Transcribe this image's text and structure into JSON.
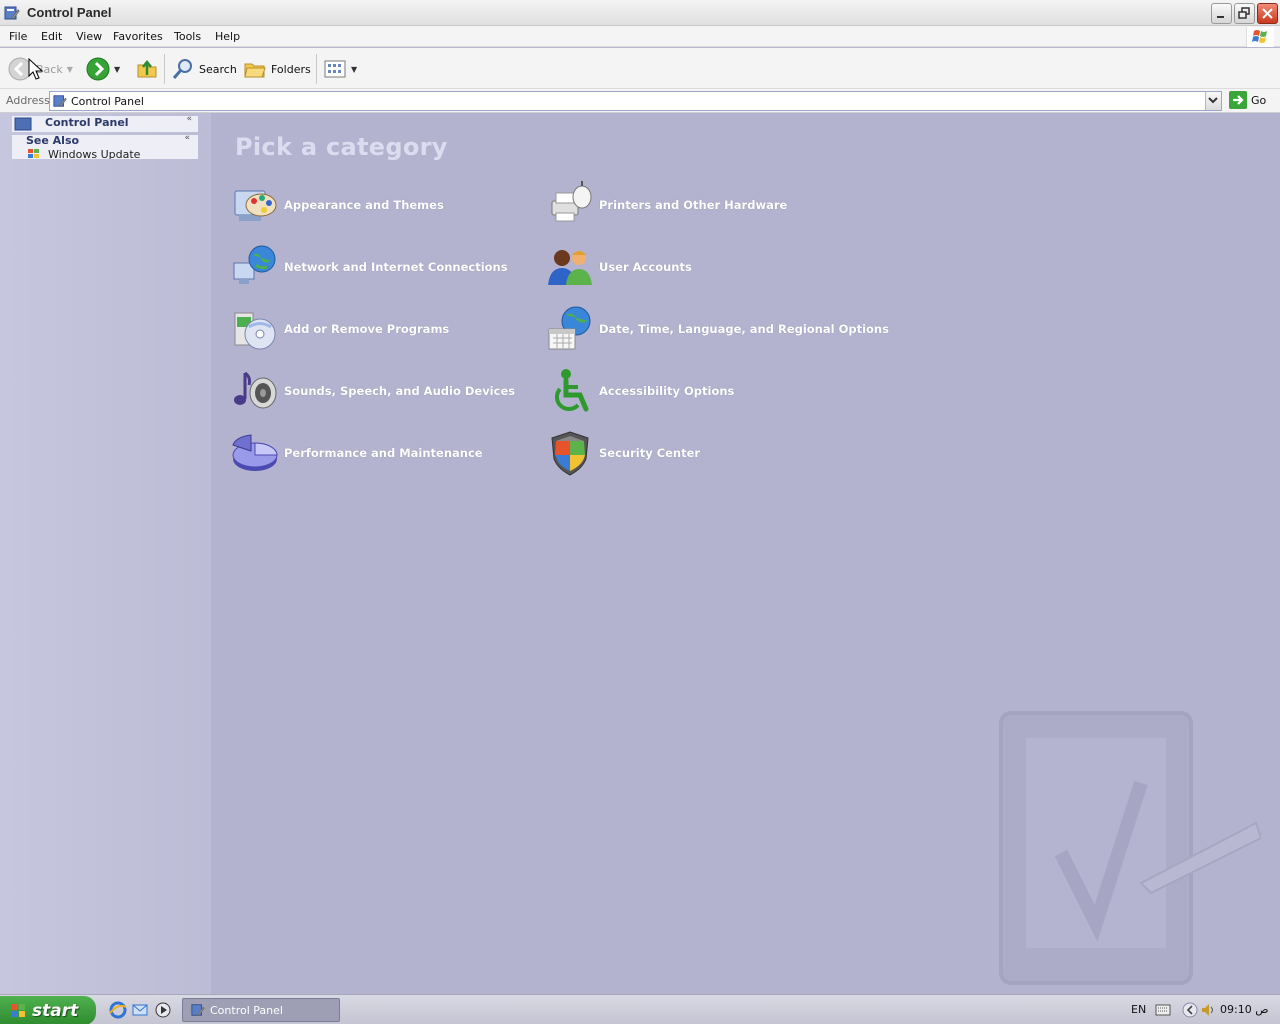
{
  "window": {
    "title": "Control Panel",
    "title_icon": "control-panel-icon",
    "buttons": [
      "minimize",
      "restore",
      "close"
    ]
  },
  "menubar": {
    "items": [
      "File",
      "Edit",
      "View",
      "Favorites",
      "Tools",
      "Help"
    ]
  },
  "toolbar": {
    "back_label": "Back",
    "search_label": "Search",
    "folders_label": "Folders"
  },
  "address": {
    "label": "Address",
    "value": "Control Panel",
    "go_label": "Go"
  },
  "leftpane": {
    "control_panel_title": "Control Panel",
    "see_also_title": "See Also",
    "see_also_links": [
      "Windows Update"
    ]
  },
  "main": {
    "heading": "Pick a category",
    "categories": [
      {
        "label": "Appearance and Themes",
        "icon": "appearance-themes-icon"
      },
      {
        "label": "Printers and Other Hardware",
        "icon": "printer-hardware-icon"
      },
      {
        "label": "Network and Internet Connections",
        "icon": "network-globe-icon"
      },
      {
        "label": "User Accounts",
        "icon": "user-accounts-icon"
      },
      {
        "label": "Add or Remove Programs",
        "icon": "add-remove-programs-icon"
      },
      {
        "label": "Date, Time, Language, and Regional Options",
        "icon": "date-time-globe-icon"
      },
      {
        "label": "Sounds, Speech, and Audio Devices",
        "icon": "sound-speaker-icon"
      },
      {
        "label": "Accessibility Options",
        "icon": "accessibility-icon"
      },
      {
        "label": "Performance and Maintenance",
        "icon": "performance-pie-icon"
      },
      {
        "label": "Security Center",
        "icon": "security-shield-icon"
      }
    ]
  },
  "taskbar": {
    "start_label": "start",
    "task_label": "Control Panel",
    "language": "EN",
    "clock": "09:10 ص"
  },
  "colors": {
    "content_bg": "#b4b3cf",
    "category_text": "#ffffff",
    "heading_text": "#dcdcf0",
    "start_green": "#3b9e3b"
  }
}
